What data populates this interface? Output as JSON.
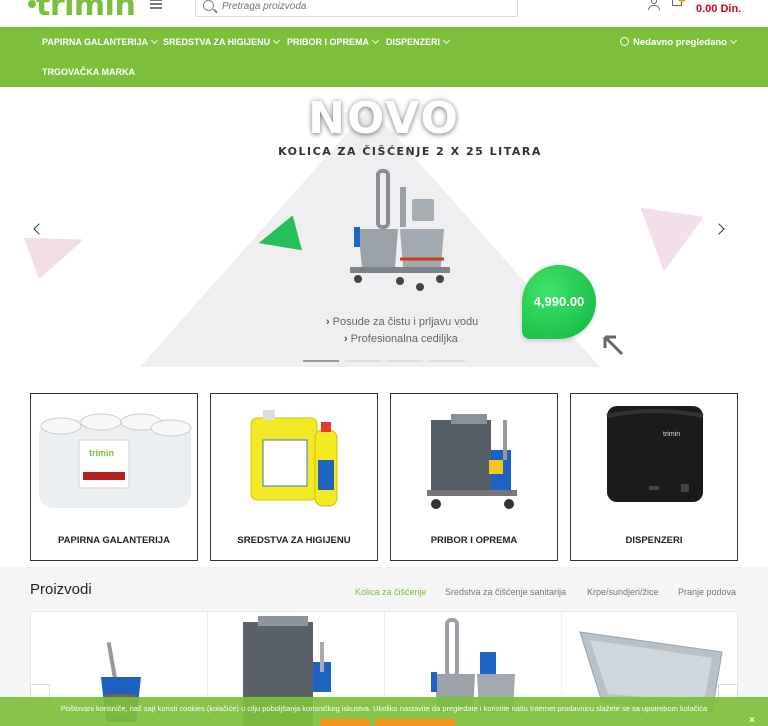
{
  "header": {
    "logo_text": "trimin",
    "search_placeholder": "Pretraga proizvoda",
    "cart_total": "0.00 Din."
  },
  "nav": {
    "items": [
      {
        "label": "PAPIRNA GALANTERIJA"
      },
      {
        "label": "SREDSTVA ZA HIGIJENU"
      },
      {
        "label": "PRIBOR I OPREMA"
      },
      {
        "label": "DISPENZERI"
      }
    ],
    "row2": "TRGOVAČKA MARKA",
    "recent": "Nedavno pregledano"
  },
  "hero": {
    "headline": "NOVO",
    "subtitle": "KOLICA ZA ČIŠĆENJE 2 X 25 LITARA",
    "price": "4,990.00",
    "features": [
      "Posude za čistu i prljavu vodu",
      "Profesionalna cediljka"
    ],
    "slide_count": 4,
    "active_slide": 0
  },
  "categories": [
    {
      "label": "PAPIRNA GALANTERIJA",
      "icon": "paper-towel-rolls"
    },
    {
      "label": "SREDSTVA ZA HIGIJENU",
      "icon": "cleaning-bottles"
    },
    {
      "label": "PRIBOR I OPREMA",
      "icon": "cleaning-trolley"
    },
    {
      "label": "DISPENZERI",
      "icon": "towel-dispenser"
    }
  ],
  "products": {
    "title": "Proizvodi",
    "tabs": [
      {
        "label": "Kolica za čišćenje",
        "active": true
      },
      {
        "label": "Sredstva za čišćenje sanitarija",
        "active": false
      },
      {
        "label": "Krpe/sundjeri/žice",
        "active": false
      },
      {
        "label": "Pranje podova",
        "active": false
      }
    ]
  },
  "cookie": {
    "text": "Poštovani korisniče, naš sajt koristi cookies (kolačiće) u cilju poboljšanja korisničkog iskustva. Ukoliko nastavite da pregledate i koristite našu Internet prodavnicu slažete se sa upotrebom kolačića"
  },
  "colors": {
    "brand_green": "#7cbf3c",
    "price_red": "#d6001c",
    "accent_orange": "#f7941d",
    "badge_green": "#26c05a"
  }
}
